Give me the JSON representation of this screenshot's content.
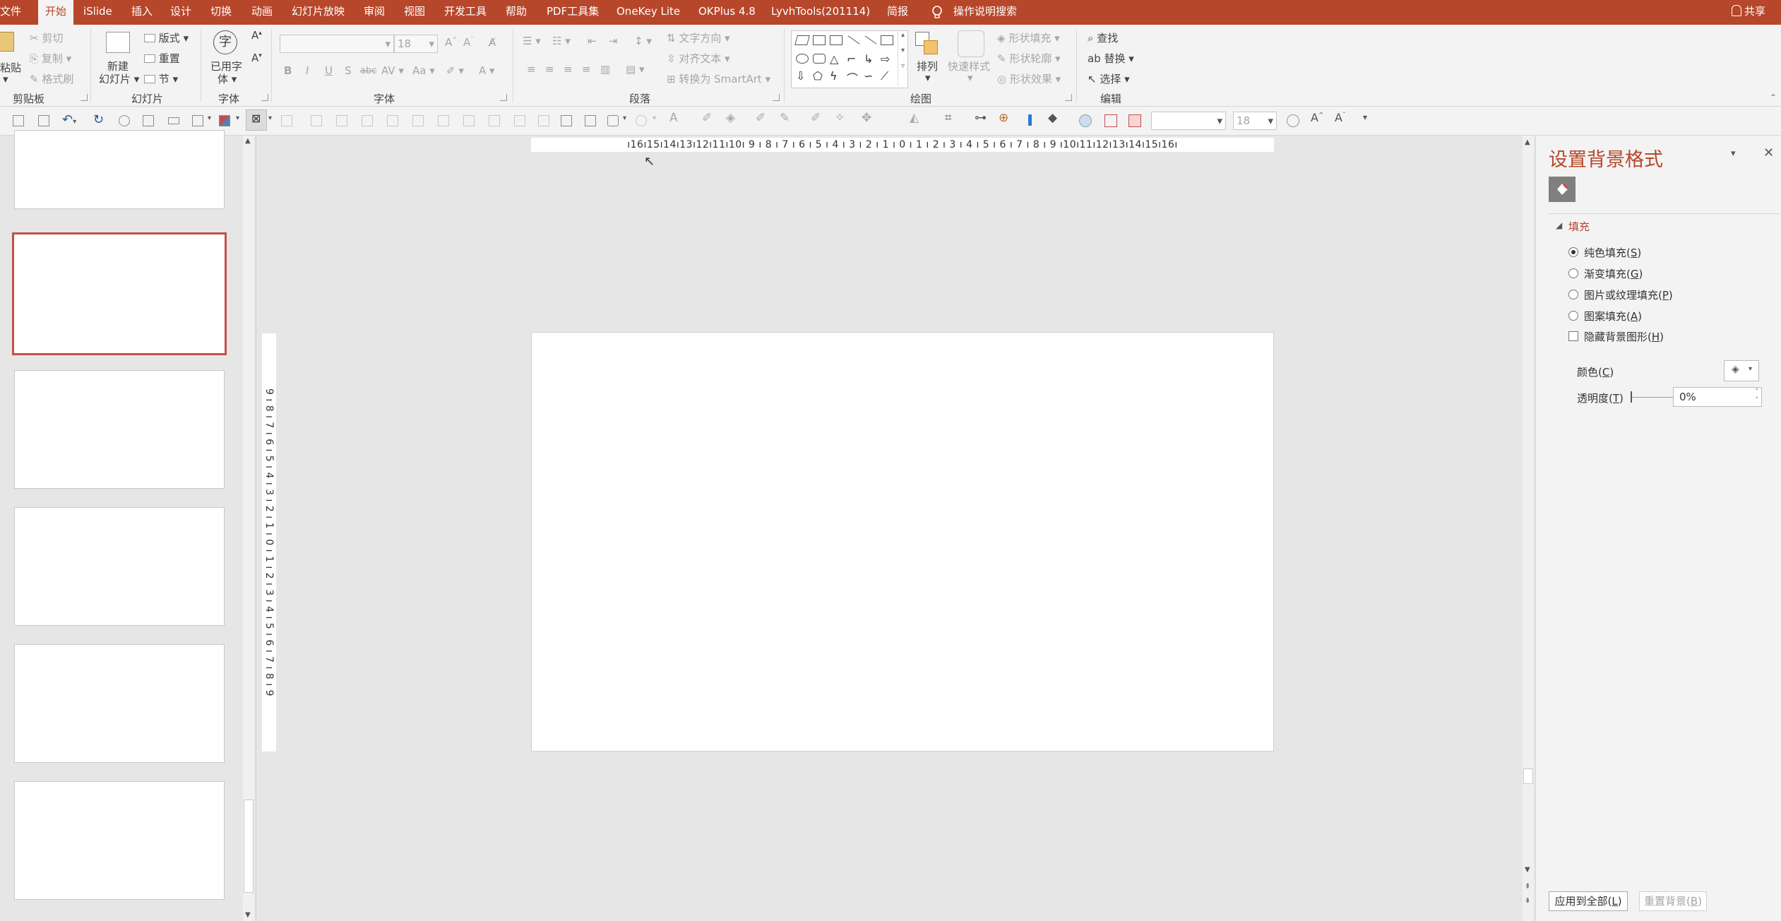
{
  "menubar": {
    "tabs": [
      "文件",
      "开始",
      "iSlide",
      "插入",
      "设计",
      "切换",
      "动画",
      "幻灯片放映",
      "审阅",
      "视图",
      "开发工具",
      "帮助",
      "PDF工具集",
      "OneKey Lite",
      "OKPlus 4.8",
      "LyvhTools(201114)",
      "简报"
    ],
    "search_label": "操作说明搜索",
    "share_label": "共享"
  },
  "ribbon": {
    "clipboard": {
      "paste": "粘贴",
      "cut": "剪切",
      "copy": "复制",
      "format_painter": "格式刷",
      "group": "剪贴板"
    },
    "slides": {
      "new_slide_line1": "新建",
      "new_slide_line2": "幻灯片",
      "layout": "版式",
      "reset": "重置",
      "section": "节",
      "group": "幻灯片"
    },
    "font_tools": {
      "used_fonts_line1": "已用字",
      "used_fonts_line2": "体",
      "group": "字体"
    },
    "font": {
      "size_value": "18",
      "bold": "B",
      "italic": "I",
      "underline": "U",
      "shadow": "S",
      "strike": "abc",
      "spacing": "AV",
      "case": "Aa",
      "font_color": "A",
      "group": "字体"
    },
    "paragraph": {
      "text_direction": "文字方向",
      "align_text": "对齐文本",
      "convert_smartart": "转换为 SmartArt",
      "group": "段落"
    },
    "drawing": {
      "arrange": "排列",
      "quick_styles": "快速样式",
      "shape_fill": "形状填充",
      "shape_outline": "形状轮廓",
      "shape_effects": "形状效果",
      "group": "绘图"
    },
    "editing": {
      "find": "查找",
      "replace": "替换",
      "select": "选择",
      "group": "编辑"
    }
  },
  "qat": {
    "font_size": "18"
  },
  "ruler": {
    "horizontal": "ı16ı15ı14ı13ı12ı11ı10ı 9 ı 8 ı 7 ı 6 ı 5 ı 4 ı 3 ı 2 ı 1 ı 0 ı 1 ı 2 ı 3 ı 4 ı 5 ı 6 ı 7 ı 8 ı 9 ı10ı11ı12ı13ı14ı15ı16ı",
    "vertical": "9 ı 8 ı 7 ı 6 ı 5 ı 4 ı 3 ı 2 ı 1 ı 0 ı 1 ı 2 ı 3 ı 4 ı 5 ı 6 ı 7 ı 8 ı 9"
  },
  "panel": {
    "title": "设置背景格式",
    "section_fill": "填充",
    "options": [
      {
        "label": "纯色填充",
        "key": "S"
      },
      {
        "label": "渐变填充",
        "key": "G"
      },
      {
        "label": "图片或纹理填充",
        "key": "P"
      },
      {
        "label": "图案填充",
        "key": "A"
      }
    ],
    "hide_graphics": {
      "label": "隐藏背景图形",
      "key": "H"
    },
    "color": {
      "label": "颜色",
      "key": "C"
    },
    "transparency": {
      "label": "透明度",
      "key": "T",
      "value": "0%"
    },
    "apply_all": {
      "label": "应用到全部",
      "key": "L"
    },
    "reset_bg": {
      "label": "重置背景",
      "key": "B"
    }
  },
  "colors": {
    "accent": "#b7472a",
    "selected_thumb": "#c0504d"
  }
}
